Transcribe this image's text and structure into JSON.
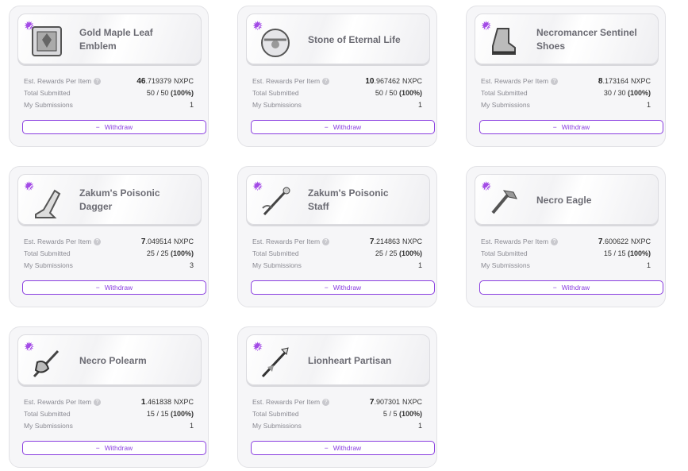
{
  "labels": {
    "est_rewards": "Est. Rewards Per Item",
    "total_submitted": "Total Submitted",
    "my_submissions": "My Submissions",
    "withdraw": "Withdraw",
    "unit": "NXPC",
    "help_glyph": "?",
    "minus_glyph": "−",
    "check_glyph": "✓"
  },
  "colors": {
    "accent": "#8a3ee0",
    "badge": "#a34be6",
    "card_bg": "#f6f6f8"
  },
  "items": [
    {
      "name_line1": "Gold Maple Leaf",
      "name_line2": "Emblem",
      "icon": "emblem-icon",
      "reward_int": "46",
      "reward_dec": ".719379",
      "submitted": "50",
      "total": "50",
      "pct": "(100%)",
      "mine": "1"
    },
    {
      "name_line1": "Stone of Eternal Life",
      "name_line2": "",
      "icon": "stone-icon",
      "reward_int": "10",
      "reward_dec": ".967462",
      "submitted": "50",
      "total": "50",
      "pct": "(100%)",
      "mine": "1"
    },
    {
      "name_line1": "Necromancer Sentinel",
      "name_line2": "Shoes",
      "icon": "shoes-icon",
      "reward_int": "8",
      "reward_dec": ".173164",
      "submitted": "30",
      "total": "30",
      "pct": "(100%)",
      "mine": "1"
    },
    {
      "name_line1": "Zakum's Poisonic",
      "name_line2": "Dagger",
      "icon": "dagger-icon",
      "reward_int": "7",
      "reward_dec": ".049514",
      "submitted": "25",
      "total": "25",
      "pct": "(100%)",
      "mine": "3"
    },
    {
      "name_line1": "Zakum's Poisonic",
      "name_line2": "Staff",
      "icon": "staff-icon",
      "reward_int": "7",
      "reward_dec": ".214863",
      "submitted": "25",
      "total": "25",
      "pct": "(100%)",
      "mine": "1"
    },
    {
      "name_line1": "Necro Eagle",
      "name_line2": "",
      "icon": "eagle-icon",
      "reward_int": "7",
      "reward_dec": ".600622",
      "submitted": "15",
      "total": "15",
      "pct": "(100%)",
      "mine": "1"
    },
    {
      "name_line1": "Necro Polearm",
      "name_line2": "",
      "icon": "polearm-icon",
      "reward_int": "1",
      "reward_dec": ".461838",
      "submitted": "15",
      "total": "15",
      "pct": "(100%)",
      "mine": "1"
    },
    {
      "name_line1": "Lionheart Partisan",
      "name_line2": "",
      "icon": "partisan-icon",
      "reward_int": "7",
      "reward_dec": ".907301",
      "submitted": "5",
      "total": "5",
      "pct": "(100%)",
      "mine": "1"
    }
  ]
}
